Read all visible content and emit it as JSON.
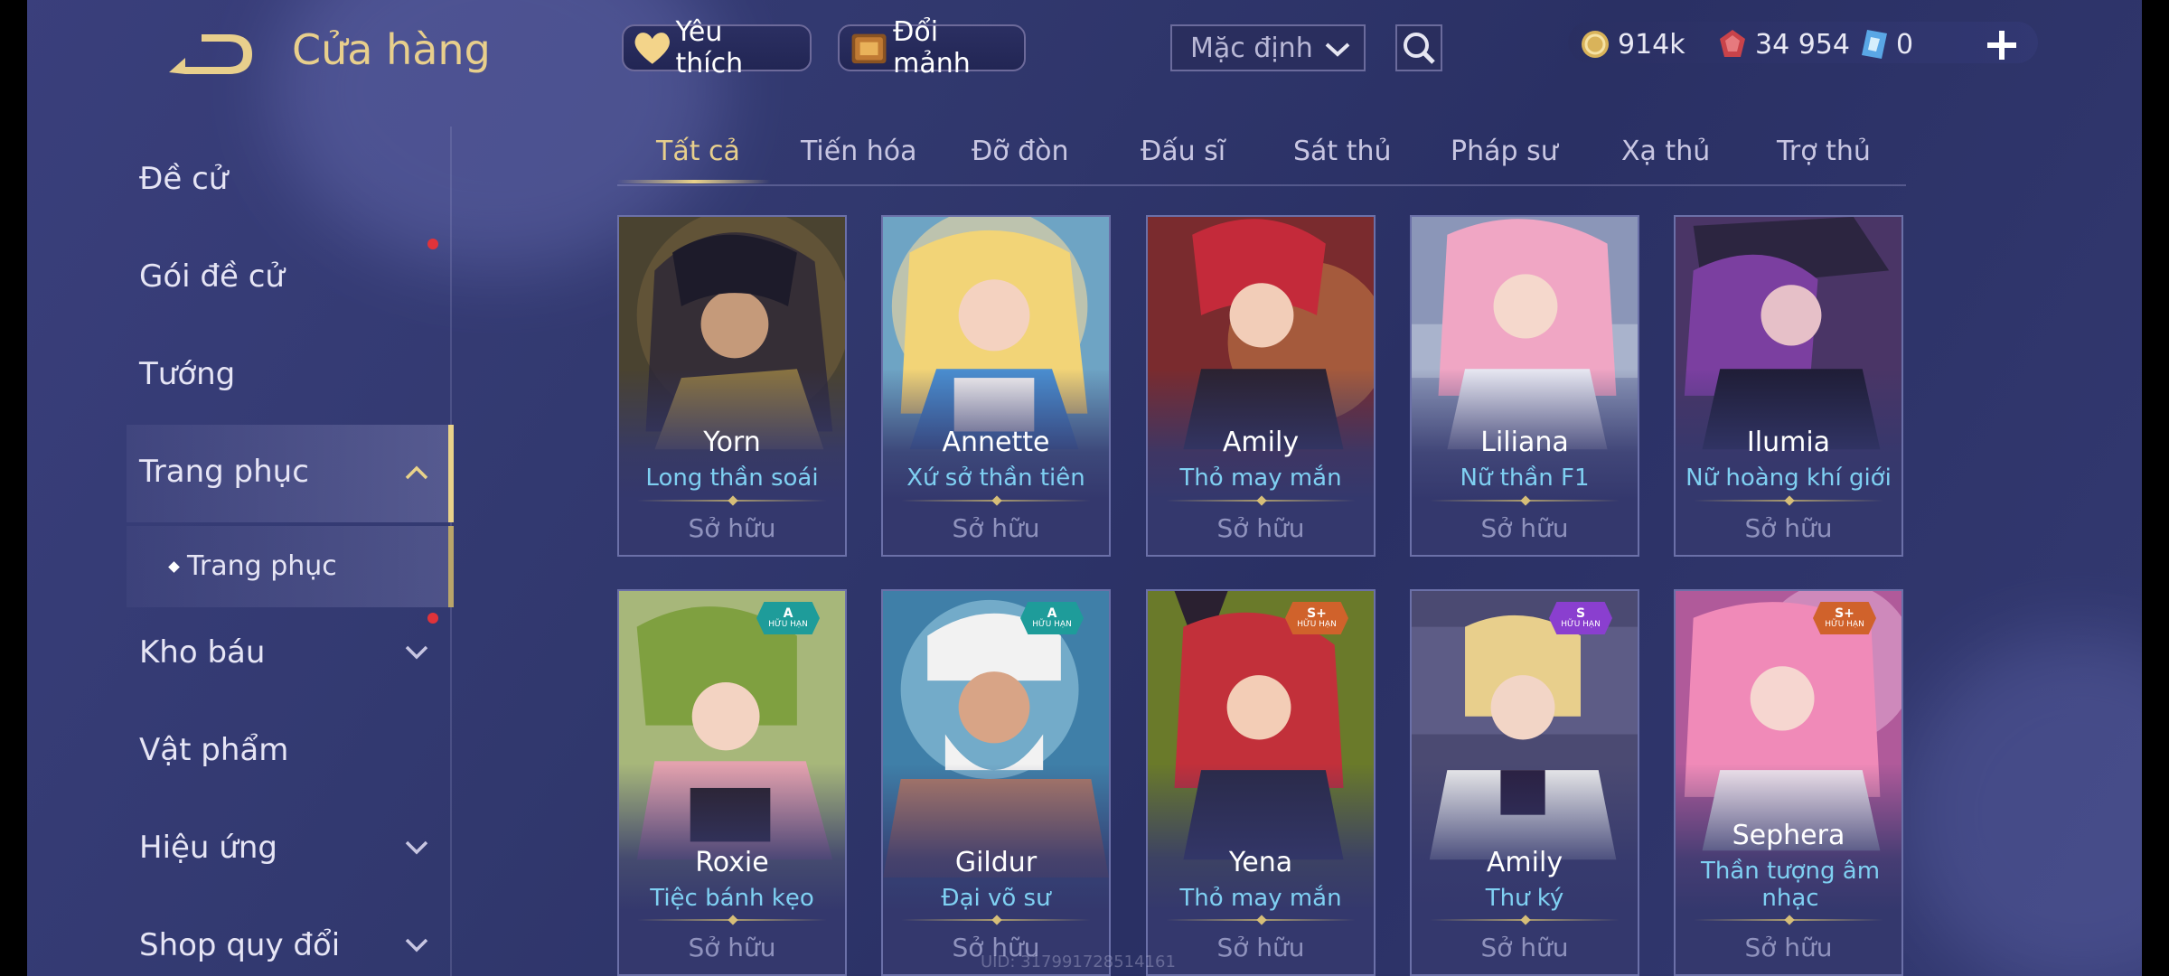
{
  "header": {
    "title": "Cửa hàng",
    "favorites_label": "Yêu thích",
    "exchange_label": "Đổi mảnh",
    "sort_selected": "Mặc định",
    "currencies": [
      {
        "icon": "gold-coin-icon",
        "value": "914k"
      },
      {
        "icon": "red-gem-icon",
        "value": "34 954"
      },
      {
        "icon": "blue-voucher-icon",
        "value": "0"
      }
    ]
  },
  "sidebar": {
    "items": [
      {
        "label": "Đề cử"
      },
      {
        "label": "Gói đề cử"
      },
      {
        "label": "Tướng"
      },
      {
        "label": "Trang phục"
      },
      {
        "label": "Trang phục"
      },
      {
        "label": "Kho báu"
      },
      {
        "label": "Vật phẩm"
      },
      {
        "label": "Hiệu ứng"
      },
      {
        "label": "Shop quy đổi"
      }
    ]
  },
  "tabs": [
    "Tất cả",
    "Tiến hóa",
    "Đỡ đòn",
    "Đấu sĩ",
    "Sát thủ",
    "Pháp sư",
    "Xạ thủ",
    "Trợ thủ"
  ],
  "cards": [
    {
      "hero": "Yorn",
      "skin": "Long thần soái",
      "status": "Sở hữu"
    },
    {
      "hero": "Annette",
      "skin": "Xứ sở thần tiên",
      "status": "Sở hữu"
    },
    {
      "hero": "Amily",
      "skin": "Thỏ may mắn",
      "status": "Sở hữu"
    },
    {
      "hero": "Liliana",
      "skin": "Nữ thần F1",
      "status": "Sở hữu"
    },
    {
      "hero": "Ilumia",
      "skin": "Nữ hoàng khí giới",
      "status": "Sở hữu"
    },
    {
      "hero": "Roxie",
      "skin": "Tiệc bánh kẹo",
      "status": "Sở hữu",
      "badge": {
        "grade": "A",
        "text": "HỮU HẠN"
      }
    },
    {
      "hero": "Gildur",
      "skin": "Đại võ sư",
      "status": "Sở hữu",
      "badge": {
        "grade": "A",
        "text": "HỮU HẠN"
      }
    },
    {
      "hero": "Yena",
      "skin": "Thỏ may mắn",
      "status": "Sở hữu",
      "badge": {
        "grade": "S+",
        "text": "HỮU HẠN"
      }
    },
    {
      "hero": "Amily",
      "skin": "Thư ký",
      "status": "Sở hữu",
      "badge": {
        "grade": "S",
        "text": "HỮU HẠN"
      }
    },
    {
      "hero": "Sephera",
      "skin": "Thần tượng âm nhạc",
      "status": "Sở hữu",
      "badge": {
        "grade": "S+",
        "text": "HỮU HẠN"
      }
    }
  ],
  "footer": {
    "uid": "UID: 3179917285141​61"
  },
  "colors": {
    "accent_gold": "#e8cf8c",
    "skin_name_blue": "#7fd0f2",
    "badge_teal": "#1e9c9a",
    "badge_orange": "#d0622b",
    "badge_purple": "#8a3fcf"
  }
}
